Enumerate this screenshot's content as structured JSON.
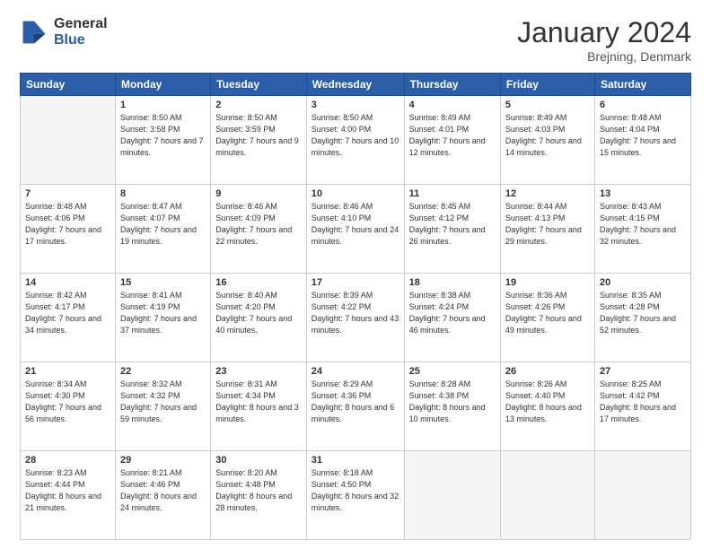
{
  "header": {
    "logo_general": "General",
    "logo_blue": "Blue",
    "month_title": "January 2024",
    "location": "Brejning, Denmark"
  },
  "weekdays": [
    "Sunday",
    "Monday",
    "Tuesday",
    "Wednesday",
    "Thursday",
    "Friday",
    "Saturday"
  ],
  "weeks": [
    [
      {
        "day": "",
        "sunrise": "",
        "sunset": "",
        "daylight": ""
      },
      {
        "day": "1",
        "sunrise": "Sunrise: 8:50 AM",
        "sunset": "Sunset: 3:58 PM",
        "daylight": "Daylight: 7 hours and 7 minutes."
      },
      {
        "day": "2",
        "sunrise": "Sunrise: 8:50 AM",
        "sunset": "Sunset: 3:59 PM",
        "daylight": "Daylight: 7 hours and 9 minutes."
      },
      {
        "day": "3",
        "sunrise": "Sunrise: 8:50 AM",
        "sunset": "Sunset: 4:00 PM",
        "daylight": "Daylight: 7 hours and 10 minutes."
      },
      {
        "day": "4",
        "sunrise": "Sunrise: 8:49 AM",
        "sunset": "Sunset: 4:01 PM",
        "daylight": "Daylight: 7 hours and 12 minutes."
      },
      {
        "day": "5",
        "sunrise": "Sunrise: 8:49 AM",
        "sunset": "Sunset: 4:03 PM",
        "daylight": "Daylight: 7 hours and 14 minutes."
      },
      {
        "day": "6",
        "sunrise": "Sunrise: 8:48 AM",
        "sunset": "Sunset: 4:04 PM",
        "daylight": "Daylight: 7 hours and 15 minutes."
      }
    ],
    [
      {
        "day": "7",
        "sunrise": "Sunrise: 8:48 AM",
        "sunset": "Sunset: 4:06 PM",
        "daylight": "Daylight: 7 hours and 17 minutes."
      },
      {
        "day": "8",
        "sunrise": "Sunrise: 8:47 AM",
        "sunset": "Sunset: 4:07 PM",
        "daylight": "Daylight: 7 hours and 19 minutes."
      },
      {
        "day": "9",
        "sunrise": "Sunrise: 8:46 AM",
        "sunset": "Sunset: 4:09 PM",
        "daylight": "Daylight: 7 hours and 22 minutes."
      },
      {
        "day": "10",
        "sunrise": "Sunrise: 8:46 AM",
        "sunset": "Sunset: 4:10 PM",
        "daylight": "Daylight: 7 hours and 24 minutes."
      },
      {
        "day": "11",
        "sunrise": "Sunrise: 8:45 AM",
        "sunset": "Sunset: 4:12 PM",
        "daylight": "Daylight: 7 hours and 26 minutes."
      },
      {
        "day": "12",
        "sunrise": "Sunrise: 8:44 AM",
        "sunset": "Sunset: 4:13 PM",
        "daylight": "Daylight: 7 hours and 29 minutes."
      },
      {
        "day": "13",
        "sunrise": "Sunrise: 8:43 AM",
        "sunset": "Sunset: 4:15 PM",
        "daylight": "Daylight: 7 hours and 32 minutes."
      }
    ],
    [
      {
        "day": "14",
        "sunrise": "Sunrise: 8:42 AM",
        "sunset": "Sunset: 4:17 PM",
        "daylight": "Daylight: 7 hours and 34 minutes."
      },
      {
        "day": "15",
        "sunrise": "Sunrise: 8:41 AM",
        "sunset": "Sunset: 4:19 PM",
        "daylight": "Daylight: 7 hours and 37 minutes."
      },
      {
        "day": "16",
        "sunrise": "Sunrise: 8:40 AM",
        "sunset": "Sunset: 4:20 PM",
        "daylight": "Daylight: 7 hours and 40 minutes."
      },
      {
        "day": "17",
        "sunrise": "Sunrise: 8:39 AM",
        "sunset": "Sunset: 4:22 PM",
        "daylight": "Daylight: 7 hours and 43 minutes."
      },
      {
        "day": "18",
        "sunrise": "Sunrise: 8:38 AM",
        "sunset": "Sunset: 4:24 PM",
        "daylight": "Daylight: 7 hours and 46 minutes."
      },
      {
        "day": "19",
        "sunrise": "Sunrise: 8:36 AM",
        "sunset": "Sunset: 4:26 PM",
        "daylight": "Daylight: 7 hours and 49 minutes."
      },
      {
        "day": "20",
        "sunrise": "Sunrise: 8:35 AM",
        "sunset": "Sunset: 4:28 PM",
        "daylight": "Daylight: 7 hours and 52 minutes."
      }
    ],
    [
      {
        "day": "21",
        "sunrise": "Sunrise: 8:34 AM",
        "sunset": "Sunset: 4:30 PM",
        "daylight": "Daylight: 7 hours and 56 minutes."
      },
      {
        "day": "22",
        "sunrise": "Sunrise: 8:32 AM",
        "sunset": "Sunset: 4:32 PM",
        "daylight": "Daylight: 7 hours and 59 minutes."
      },
      {
        "day": "23",
        "sunrise": "Sunrise: 8:31 AM",
        "sunset": "Sunset: 4:34 PM",
        "daylight": "Daylight: 8 hours and 3 minutes."
      },
      {
        "day": "24",
        "sunrise": "Sunrise: 8:29 AM",
        "sunset": "Sunset: 4:36 PM",
        "daylight": "Daylight: 8 hours and 6 minutes."
      },
      {
        "day": "25",
        "sunrise": "Sunrise: 8:28 AM",
        "sunset": "Sunset: 4:38 PM",
        "daylight": "Daylight: 8 hours and 10 minutes."
      },
      {
        "day": "26",
        "sunrise": "Sunrise: 8:26 AM",
        "sunset": "Sunset: 4:40 PM",
        "daylight": "Daylight: 8 hours and 13 minutes."
      },
      {
        "day": "27",
        "sunrise": "Sunrise: 8:25 AM",
        "sunset": "Sunset: 4:42 PM",
        "daylight": "Daylight: 8 hours and 17 minutes."
      }
    ],
    [
      {
        "day": "28",
        "sunrise": "Sunrise: 8:23 AM",
        "sunset": "Sunset: 4:44 PM",
        "daylight": "Daylight: 8 hours and 21 minutes."
      },
      {
        "day": "29",
        "sunrise": "Sunrise: 8:21 AM",
        "sunset": "Sunset: 4:46 PM",
        "daylight": "Daylight: 8 hours and 24 minutes."
      },
      {
        "day": "30",
        "sunrise": "Sunrise: 8:20 AM",
        "sunset": "Sunset: 4:48 PM",
        "daylight": "Daylight: 8 hours and 28 minutes."
      },
      {
        "day": "31",
        "sunrise": "Sunrise: 8:18 AM",
        "sunset": "Sunset: 4:50 PM",
        "daylight": "Daylight: 8 hours and 32 minutes."
      },
      {
        "day": "",
        "sunrise": "",
        "sunset": "",
        "daylight": ""
      },
      {
        "day": "",
        "sunrise": "",
        "sunset": "",
        "daylight": ""
      },
      {
        "day": "",
        "sunrise": "",
        "sunset": "",
        "daylight": ""
      }
    ]
  ]
}
